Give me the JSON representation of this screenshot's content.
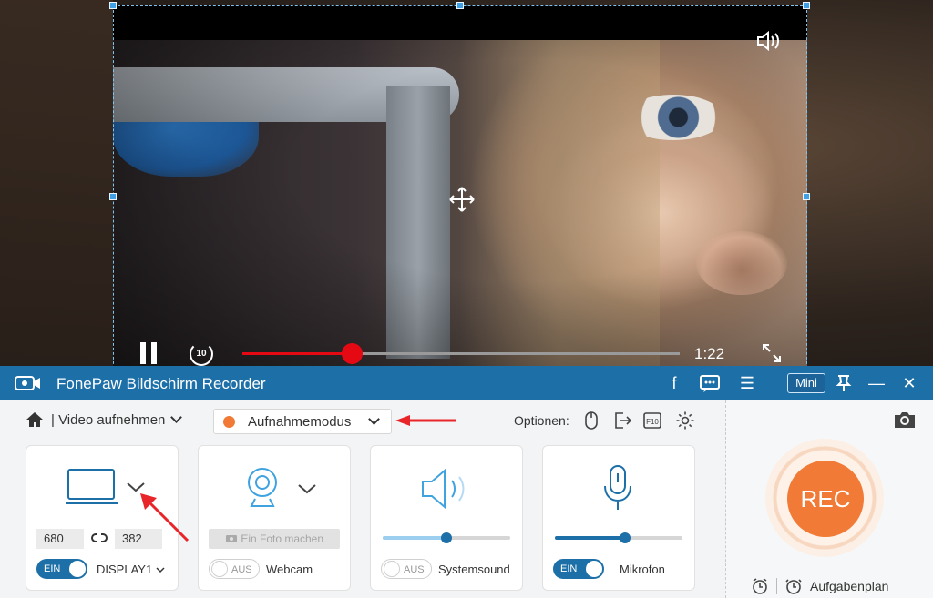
{
  "video": {
    "time": "1:22",
    "progress": 0.25
  },
  "app": {
    "title": "FonePaw Bildschirm Recorder",
    "mini_label": "Mini"
  },
  "nav": {
    "mode_label": "| Video aufnehmen",
    "recording_mode": "Aufnahmemodus",
    "options_label": "Optionen:"
  },
  "display": {
    "width": "680",
    "height": "382",
    "toggle": "EIN",
    "source": "DISPLAY1"
  },
  "webcam": {
    "photo_button": "Ein Foto machen",
    "toggle": "AUS",
    "label": "Webcam"
  },
  "system_sound": {
    "toggle": "AUS",
    "label": "Systemsound",
    "volume": 0.5
  },
  "microphone": {
    "toggle": "EIN",
    "label": "Mikrofon",
    "volume": 0.55
  },
  "rec": {
    "label": "REC"
  },
  "schedule": {
    "label": "Aufgabenplan"
  },
  "colors": {
    "accent": "#1d6fa8",
    "rec": "#f07a36",
    "progress": "#e50914"
  }
}
